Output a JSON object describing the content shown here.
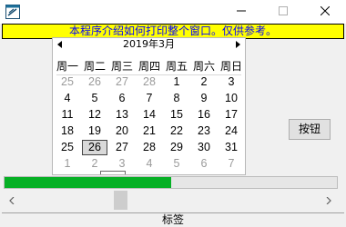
{
  "window": {
    "icon": "app-window-icon",
    "controls": {
      "minimize": "minimize-icon",
      "maximize": "maximize-icon",
      "close": "close-icon"
    }
  },
  "banner": {
    "text": "本程序介绍如何打印整个窗口。仅供参考。",
    "bg": "#ffff00",
    "color": "#0000ff"
  },
  "calendar": {
    "title": "2019年3月",
    "weekdays": [
      "周一",
      "周二",
      "周三",
      "周四",
      "周五",
      "周六",
      "周日"
    ],
    "weeks": [
      [
        "25",
        "26",
        "27",
        "28",
        "1",
        "2",
        "3"
      ],
      [
        "4",
        "5",
        "6",
        "7",
        "8",
        "9",
        "10"
      ],
      [
        "11",
        "12",
        "13",
        "14",
        "15",
        "16",
        "17"
      ],
      [
        "18",
        "19",
        "20",
        "21",
        "22",
        "23",
        "24"
      ],
      [
        "25",
        "26",
        "27",
        "28",
        "29",
        "30",
        "31"
      ],
      [
        "1",
        "2",
        "3",
        "4",
        "5",
        "6",
        "7"
      ]
    ],
    "other_month": [
      [
        true,
        true,
        true,
        true,
        false,
        false,
        false
      ],
      [
        false,
        false,
        false,
        false,
        false,
        false,
        false
      ],
      [
        false,
        false,
        false,
        false,
        false,
        false,
        false
      ],
      [
        false,
        false,
        false,
        false,
        false,
        false,
        false
      ],
      [
        false,
        false,
        false,
        false,
        false,
        false,
        false
      ],
      [
        true,
        true,
        true,
        true,
        true,
        true,
        true
      ]
    ],
    "selected": "26"
  },
  "button": {
    "label": "按钮"
  },
  "progress": {
    "value": 0.5,
    "color": "#06b025"
  },
  "scrollbar": {
    "position": 0.33
  },
  "status": {
    "label": "标签"
  }
}
